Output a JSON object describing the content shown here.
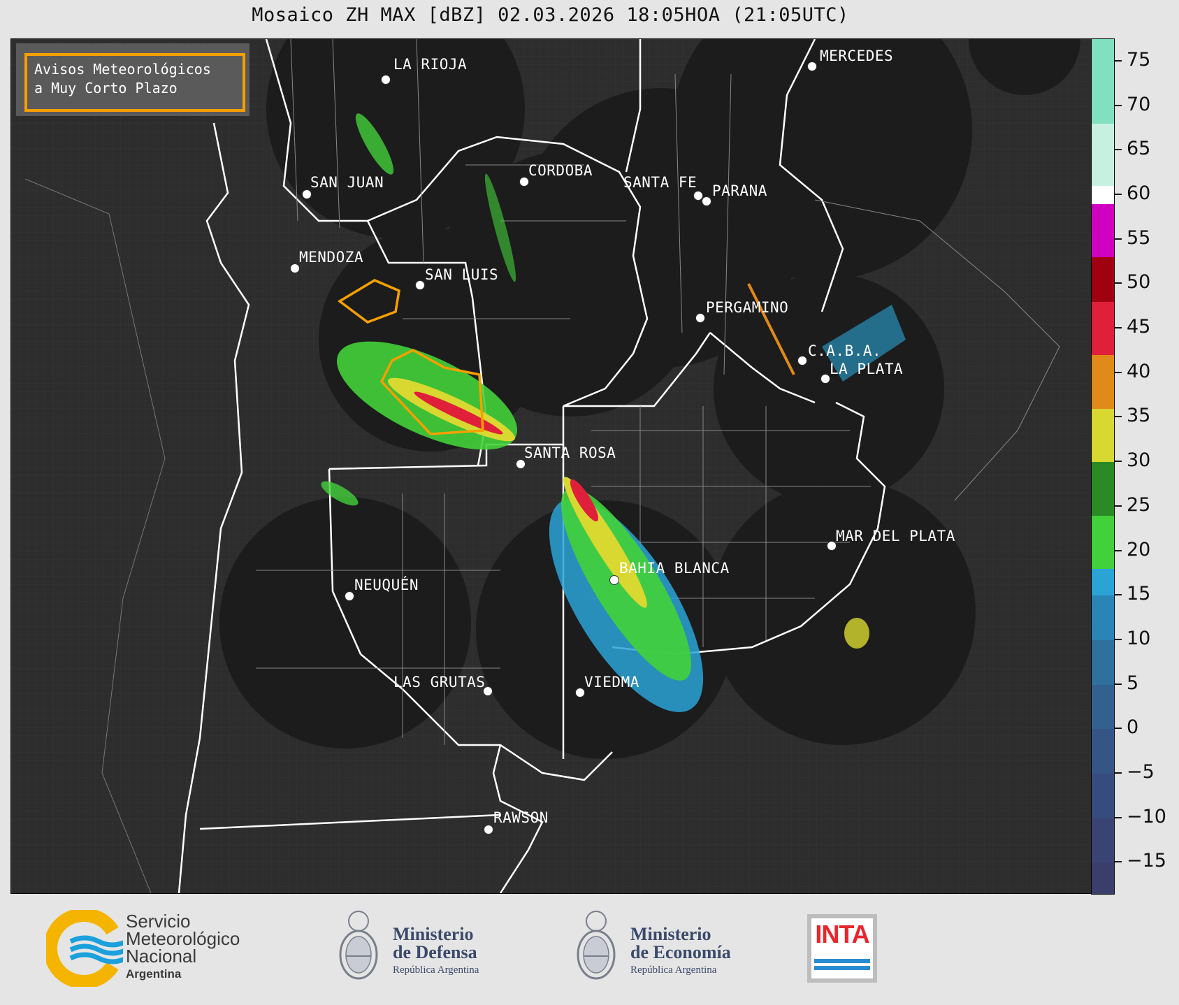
{
  "title": "Mosaico ZH MAX [dBZ] 02.03.2026 18:05HOA (21:05UTC)",
  "avisos": {
    "line1": "Avisos Meteorológicos",
    "line2": "a Muy Corto Plazo",
    "color": "#f5a000"
  },
  "cities": [
    {
      "name": "LA RIOJA"
    },
    {
      "name": "MERCEDES"
    },
    {
      "name": "SAN JUAN"
    },
    {
      "name": "CORDOBA"
    },
    {
      "name": "SANTA FE"
    },
    {
      "name": "PARANA"
    },
    {
      "name": "MENDOZA"
    },
    {
      "name": "SAN LUIS"
    },
    {
      "name": "PERGAMINO"
    },
    {
      "name": "C.A.B.A."
    },
    {
      "name": "LA PLATA"
    },
    {
      "name": "SANTA ROSA"
    },
    {
      "name": "MAR DEL PLATA"
    },
    {
      "name": "BAHIA BLANCA"
    },
    {
      "name": "NEUQUÉN"
    },
    {
      "name": "LAS GRUTAS"
    },
    {
      "name": "VIEDMA"
    },
    {
      "name": "RAWSON"
    }
  ],
  "colorbar": {
    "ticks": [
      "75",
      "70",
      "65",
      "60",
      "55",
      "50",
      "45",
      "40",
      "35",
      "30",
      "25",
      "20",
      "15",
      "10",
      "5",
      "0",
      "−5",
      "−10",
      "−15"
    ],
    "range": [
      -18.5,
      77.5
    ],
    "bands": [
      {
        "from": -18.5,
        "to": -15,
        "color": "#3b3d6b"
      },
      {
        "from": -15,
        "to": -10,
        "color": "#3a4474"
      },
      {
        "from": -10,
        "to": -5,
        "color": "#374c7e"
      },
      {
        "from": -5,
        "to": 0,
        "color": "#355586"
      },
      {
        "from": 0,
        "to": 5,
        "color": "#32618f"
      },
      {
        "from": 5,
        "to": 10,
        "color": "#2f709c"
      },
      {
        "from": 10,
        "to": 15,
        "color": "#2a84b5"
      },
      {
        "from": 15,
        "to": 18,
        "color": "#2aa3d6"
      },
      {
        "from": 18,
        "to": 24,
        "color": "#42d13a"
      },
      {
        "from": 24,
        "to": 30,
        "color": "#2a8a25"
      },
      {
        "from": 30,
        "to": 36,
        "color": "#d8d830"
      },
      {
        "from": 36,
        "to": 42,
        "color": "#e08a1a"
      },
      {
        "from": 42,
        "to": 48,
        "color": "#e0203a"
      },
      {
        "from": 48,
        "to": 53,
        "color": "#a00010"
      },
      {
        "from": 53,
        "to": 59,
        "color": "#d000c0"
      },
      {
        "from": 59,
        "to": 61,
        "color": "#ffffff"
      },
      {
        "from": 61,
        "to": 68,
        "color": "#c8f0e0"
      },
      {
        "from": 68,
        "to": 77.5,
        "color": "#80e0c0"
      }
    ]
  },
  "footer": {
    "smn": {
      "line1": "Servicio",
      "line2": "Meteorológico",
      "line3": "Nacional",
      "line4": "Argentina"
    },
    "defensa": {
      "title1": "Ministerio",
      "title2": "de Defensa",
      "sub": "República Argentina"
    },
    "economia": {
      "title1": "Ministerio",
      "title2": "de Economía",
      "sub": "República Argentina"
    },
    "inta": {
      "label": "INTA"
    },
    "colors": {
      "smn_yellow": "#f5b400",
      "smn_blue": "#1aa0dc",
      "inta_red": "#e8262d",
      "inta_blue": "#2a8cd0"
    }
  }
}
